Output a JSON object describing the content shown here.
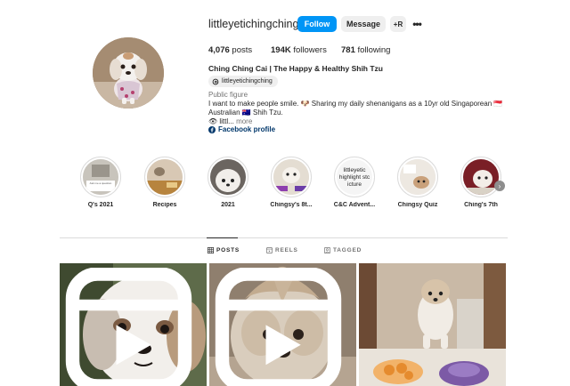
{
  "profile": {
    "username": "littleyetichingching",
    "follow_label": "Follow",
    "message_label": "Message",
    "suggest_label": "+R",
    "more_label": "•••",
    "stats": {
      "posts_count": "4,076",
      "posts_label": " posts",
      "followers_count": "194K",
      "followers_label": " followers",
      "following_count": "781",
      "following_label": " following"
    },
    "full_name": "Ching Ching Cai | The Happy & Healthy Shih Tzu",
    "threads_handle": "littleyetichingching",
    "category": "Public figure",
    "bio_line1": "I want to make people smile. 🐶 Sharing my daily shenanigans as a 10yr old Singaporean 🇸🇬",
    "bio_line2": "Australian 🇦🇺 Shih Tzu.",
    "bio_more_prefix": "👁 littl...",
    "bio_more_link": "more",
    "facebook_link": "Facebook profile"
  },
  "highlights": [
    {
      "label": "Q's 2021",
      "thumb_text": "Ask me a question"
    },
    {
      "label": "Recipes",
      "thumb_text": ""
    },
    {
      "label": "2021",
      "thumb_text": ""
    },
    {
      "label": "Chingsy's 8t...",
      "thumb_text": ""
    },
    {
      "label": "C&C Advent...",
      "thumb_text": "littleyetic highlight stc icture"
    },
    {
      "label": "Chingsy Quiz",
      "thumb_text": ""
    },
    {
      "label": "Ching's 7th",
      "thumb_text": ""
    }
  ],
  "tabs": [
    {
      "label": "POSTS",
      "active": true,
      "icon": "grid-icon"
    },
    {
      "label": "REELS",
      "active": false,
      "icon": "reels-icon"
    },
    {
      "label": "TAGGED",
      "active": false,
      "icon": "tagged-icon"
    }
  ],
  "posts": [
    {
      "type": "reel",
      "icon": "reel-icon"
    },
    {
      "type": "reel",
      "icon": "reel-icon"
    },
    {
      "type": "photo",
      "icon": ""
    }
  ],
  "colors": {
    "primary_button": "#0095f6",
    "secondary_button": "#efefef",
    "link": "#00376b",
    "text": "#262626",
    "muted": "#737373",
    "divider": "#dbdbdb"
  }
}
